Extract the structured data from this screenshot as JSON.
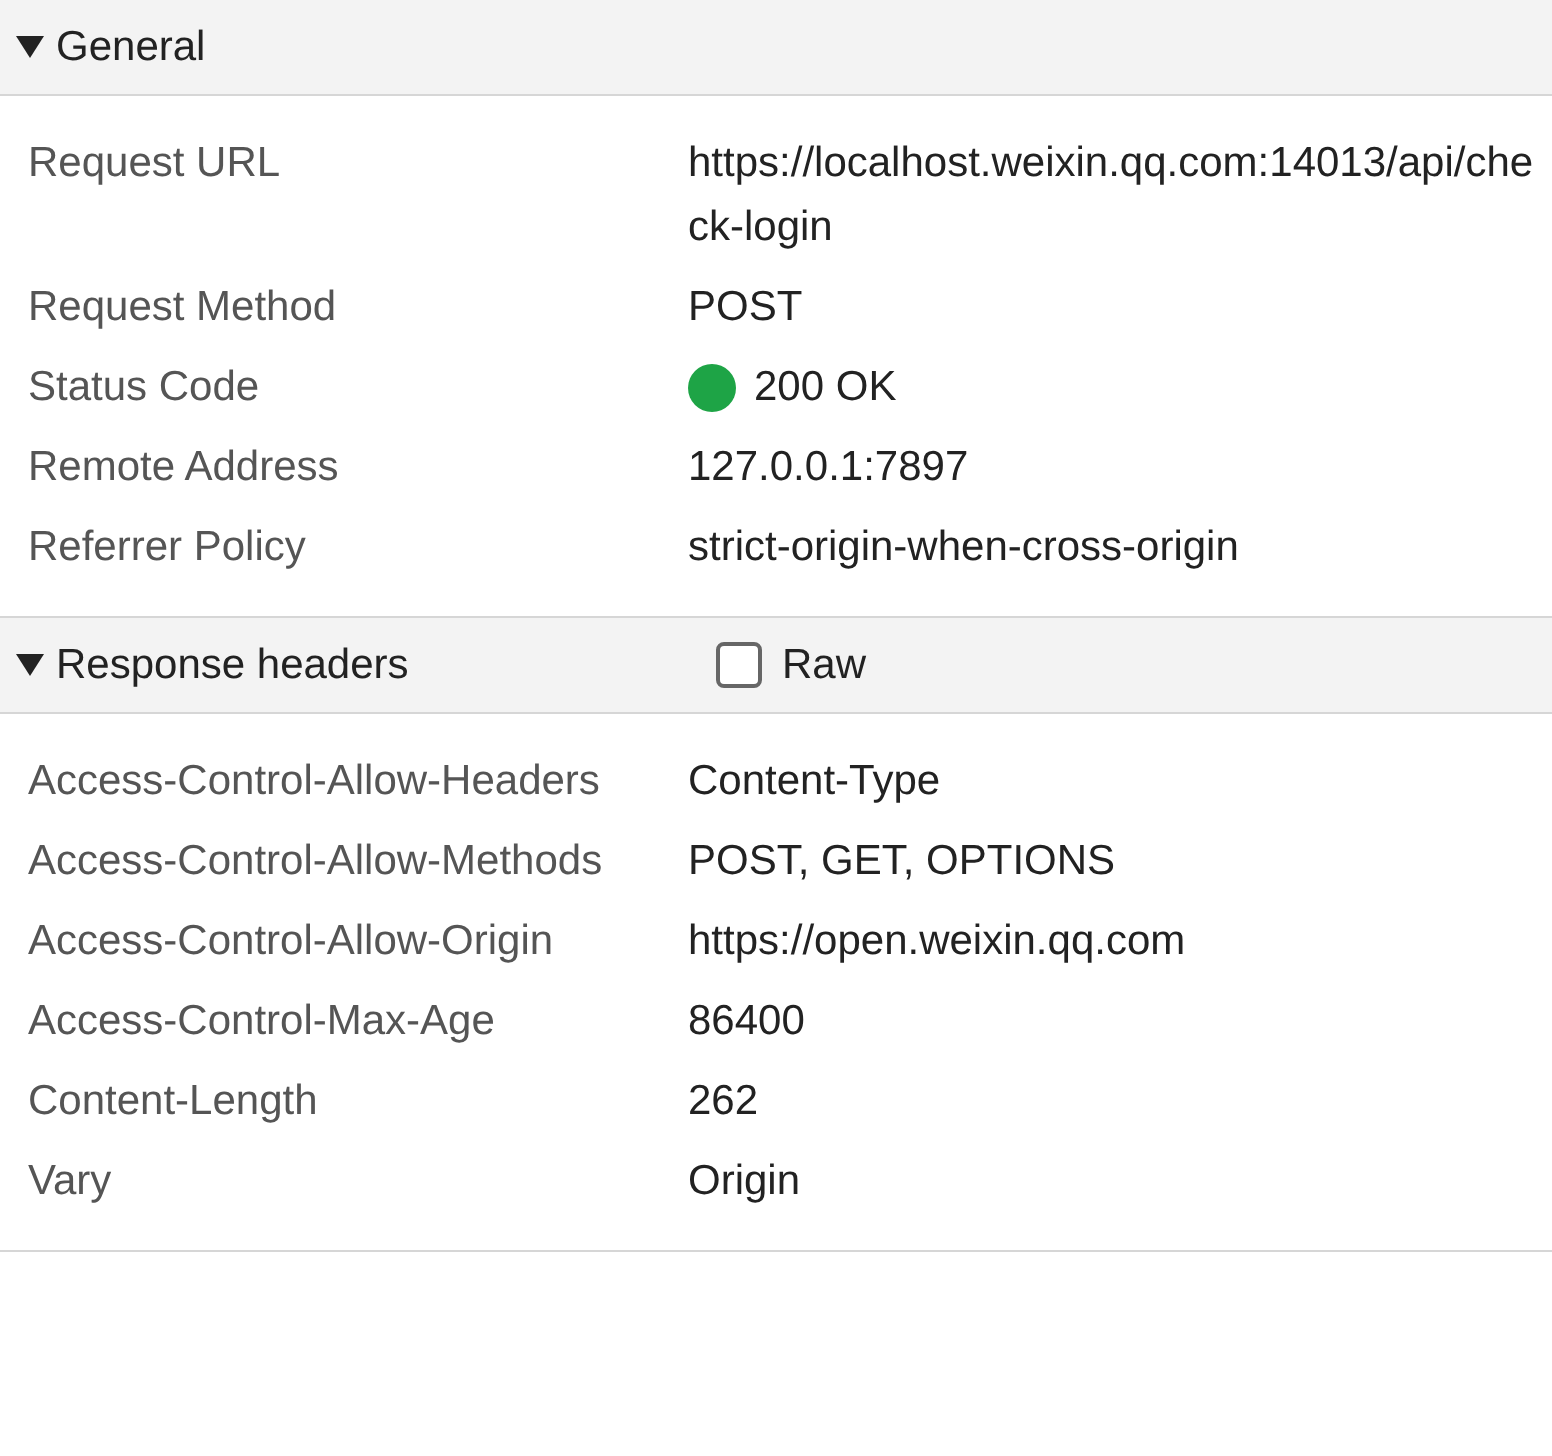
{
  "sections": [
    {
      "title": "General",
      "expanded": true,
      "rows": [
        {
          "label": "Request URL",
          "value": "https://localhost.weixin.qq.com:14013/api/check-login"
        },
        {
          "label": "Request Method",
          "value": "POST"
        },
        {
          "label": "Status Code",
          "value": "200 OK",
          "kind": "status",
          "color": "#1ea446"
        },
        {
          "label": "Remote Address",
          "value": "127.0.0.1:7897"
        },
        {
          "label": "Referrer Policy",
          "value": "strict-origin-when-cross-origin"
        }
      ]
    },
    {
      "title": "Response headers",
      "expanded": true,
      "raw": {
        "label": "Raw",
        "checked": false
      },
      "rows": [
        {
          "label": "Access-Control-Allow-Headers",
          "value": "Content-Type"
        },
        {
          "label": "Access-Control-Allow-Methods",
          "value": "POST, GET, OPTIONS"
        },
        {
          "label": "Access-Control-Allow-Origin",
          "value": "https://open.weixin.qq.com"
        },
        {
          "label": "Access-Control-Max-Age",
          "value": "86400"
        },
        {
          "label": "Content-Length",
          "value": "262"
        },
        {
          "label": "Vary",
          "value": "Origin"
        }
      ]
    }
  ]
}
